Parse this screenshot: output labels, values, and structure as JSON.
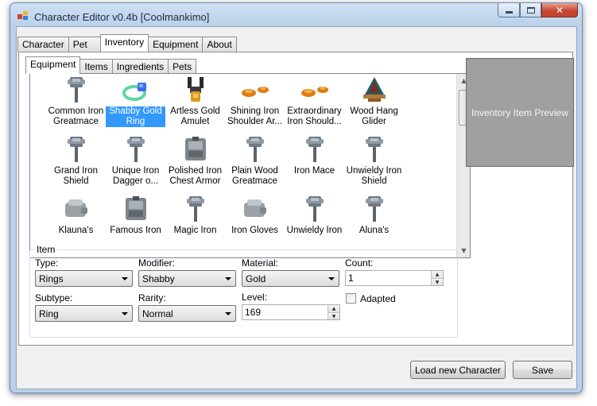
{
  "window": {
    "title": "Character Editor v0.4b [Coolmankimo]",
    "close_glyph": "✕"
  },
  "main_tabs": [
    {
      "label": "Character",
      "active": false
    },
    {
      "label": "Pet",
      "active": false
    },
    {
      "label": "Inventory",
      "active": true
    },
    {
      "label": "Equipment",
      "active": false
    },
    {
      "label": "About",
      "active": false
    }
  ],
  "sub_tabs": [
    {
      "label": "Equipment",
      "active": true
    },
    {
      "label": "Items",
      "active": false
    },
    {
      "label": "Ingredients",
      "active": false
    },
    {
      "label": "Pets",
      "active": false
    }
  ],
  "items": [
    {
      "label": "Common Iron Greatmace",
      "icon": "mace-icon"
    },
    {
      "label": "Shabby Gold Ring",
      "icon": "ring-icon",
      "selected": true
    },
    {
      "label": "Artless Gold Amulet",
      "icon": "amulet-icon"
    },
    {
      "label": "Shining Iron Shoulder Ar...",
      "icon": "shoulder-armor-icon"
    },
    {
      "label": "Extraordinary Iron Should...",
      "icon": "shoulder-armor-icon"
    },
    {
      "label": "Wood Hang Glider",
      "icon": "glider-icon"
    },
    {
      "label": "Grand Iron Shield",
      "icon": "mace-icon"
    },
    {
      "label": "Unique Iron Dagger o...",
      "icon": "mace-icon"
    },
    {
      "label": "Polished Iron Chest Armor",
      "icon": "chest-armor-icon"
    },
    {
      "label": "Plain Wood Greatmace",
      "icon": "mace-icon"
    },
    {
      "label": "Iron Mace",
      "icon": "mace-icon"
    },
    {
      "label": "Unwieldy Iron Shield",
      "icon": "mace-icon"
    },
    {
      "label": "Klauna's",
      "icon": "gloves-icon"
    },
    {
      "label": "Famous Iron",
      "icon": "chest-armor-icon"
    },
    {
      "label": "Magic Iron",
      "icon": "mace-icon"
    },
    {
      "label": "Iron Gloves",
      "icon": "gloves-icon"
    },
    {
      "label": "Unwieldy Iron",
      "icon": "mace-icon"
    },
    {
      "label": "Aluna's",
      "icon": "mace-icon"
    }
  ],
  "scrollbar": {
    "up_glyph": "▲",
    "down_glyph": "▼"
  },
  "preview": {
    "text": "Inventory Item Preview"
  },
  "item_group": {
    "legend": "Item",
    "type": {
      "label": "Type:",
      "value": "Rings"
    },
    "modifier": {
      "label": "Modifier:",
      "value": "Shabby"
    },
    "material": {
      "label": "Material:",
      "value": "Gold"
    },
    "count": {
      "label": "Count:",
      "value": "1"
    },
    "subtype": {
      "label": "Subtype:",
      "value": "Ring"
    },
    "rarity": {
      "label": "Rarity:",
      "value": "Normal"
    },
    "level": {
      "label": "Level:",
      "value": "169"
    },
    "adapted": {
      "label": "Adapted",
      "checked": false
    }
  },
  "spin": {
    "up_glyph": "▲",
    "down_glyph": "▼"
  },
  "buttons": {
    "load": "Load new Character",
    "save": "Save"
  }
}
